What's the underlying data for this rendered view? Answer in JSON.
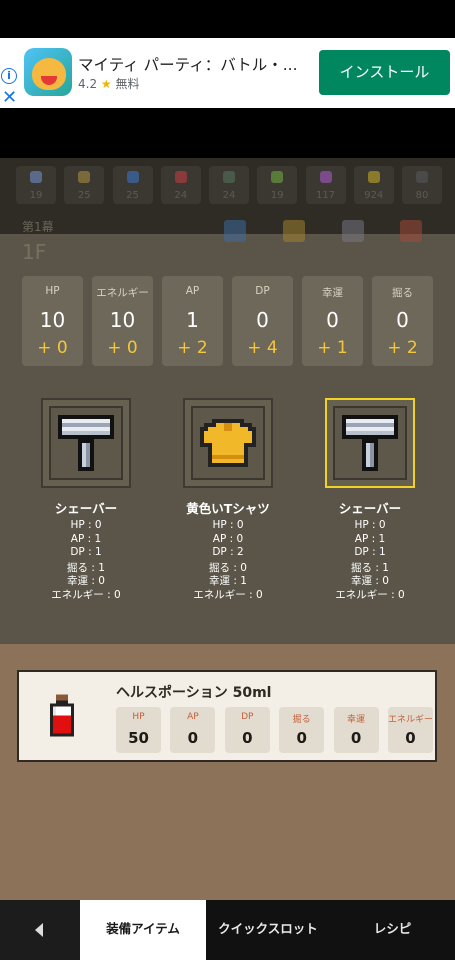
{
  "ad": {
    "app_title": "マイティ パーティ：バトル・...",
    "rating": "4.2",
    "star": "★",
    "price": "無料",
    "install_label": "インストール",
    "info_glyph": "i",
    "close_glyph": "✕"
  },
  "resources": [
    {
      "value": "19",
      "color": "#5a6a8a"
    },
    {
      "value": "25",
      "color": "#7a6a3a"
    },
    {
      "value": "25",
      "color": "#3a5a8a"
    },
    {
      "value": "24",
      "color": "#8a3a3a"
    },
    {
      "value": "24",
      "color": "#4a5a4a"
    },
    {
      "value": "19",
      "color": "#5a7a3a"
    },
    {
      "value": "117",
      "color": "#7a4a8a"
    },
    {
      "value": "924",
      "color": "#8a7a2a"
    },
    {
      "value": "80",
      "color": "#4a4a4a"
    }
  ],
  "stage": {
    "label": "第1幕",
    "floor": "1F"
  },
  "stats": [
    {
      "label": "HP",
      "value": "10",
      "bonus": "+ 0"
    },
    {
      "label": "エネルギー",
      "value": "10",
      "bonus": "+ 0"
    },
    {
      "label": "AP",
      "value": "1",
      "bonus": "+ 2"
    },
    {
      "label": "DP",
      "value": "0",
      "bonus": "+ 4"
    },
    {
      "label": "幸運",
      "value": "0",
      "bonus": "+ 1"
    },
    {
      "label": "掘る",
      "value": "0",
      "bonus": "+ 2"
    }
  ],
  "equipment": [
    {
      "name": "シェーバー",
      "icon": "shaver-icon",
      "selected": false,
      "lines": [
        "HP : 0",
        "AP : 1",
        "DP : 1",
        "掘る : 1",
        "幸運 : 0",
        "エネルギー : 0"
      ]
    },
    {
      "name": "黄色いTシャツ",
      "icon": "yellow-tshirt-icon",
      "selected": false,
      "lines": [
        "HP : 0",
        "AP : 0",
        "DP : 2",
        "掘る : 0",
        "幸運 : 1",
        "エネルギー : 0"
      ]
    },
    {
      "name": "シェーバー",
      "icon": "shaver-icon",
      "selected": true,
      "lines": [
        "HP : 0",
        "AP : 1",
        "DP : 1",
        "掘る : 1",
        "幸運 : 0",
        "エネルギー : 0"
      ]
    }
  ],
  "potion": {
    "name": "ヘルスポーション 50ml",
    "icon": "health-potion-icon",
    "stats": [
      {
        "label": "HP",
        "value": "50"
      },
      {
        "label": "AP",
        "value": "0"
      },
      {
        "label": "DP",
        "value": "0"
      },
      {
        "label": "掘る",
        "value": "0"
      },
      {
        "label": "幸運",
        "value": "0"
      },
      {
        "label": "エネルギー",
        "value": "0"
      }
    ]
  },
  "tabs": [
    {
      "label": "装備アイテム",
      "active": true
    },
    {
      "label": "クイックスロット",
      "active": false
    },
    {
      "label": "レシピ",
      "active": false
    }
  ],
  "colors": {
    "accent_bonus": "#f5c63a",
    "selected_frame": "#f2d321",
    "install_green": "#01875f"
  }
}
